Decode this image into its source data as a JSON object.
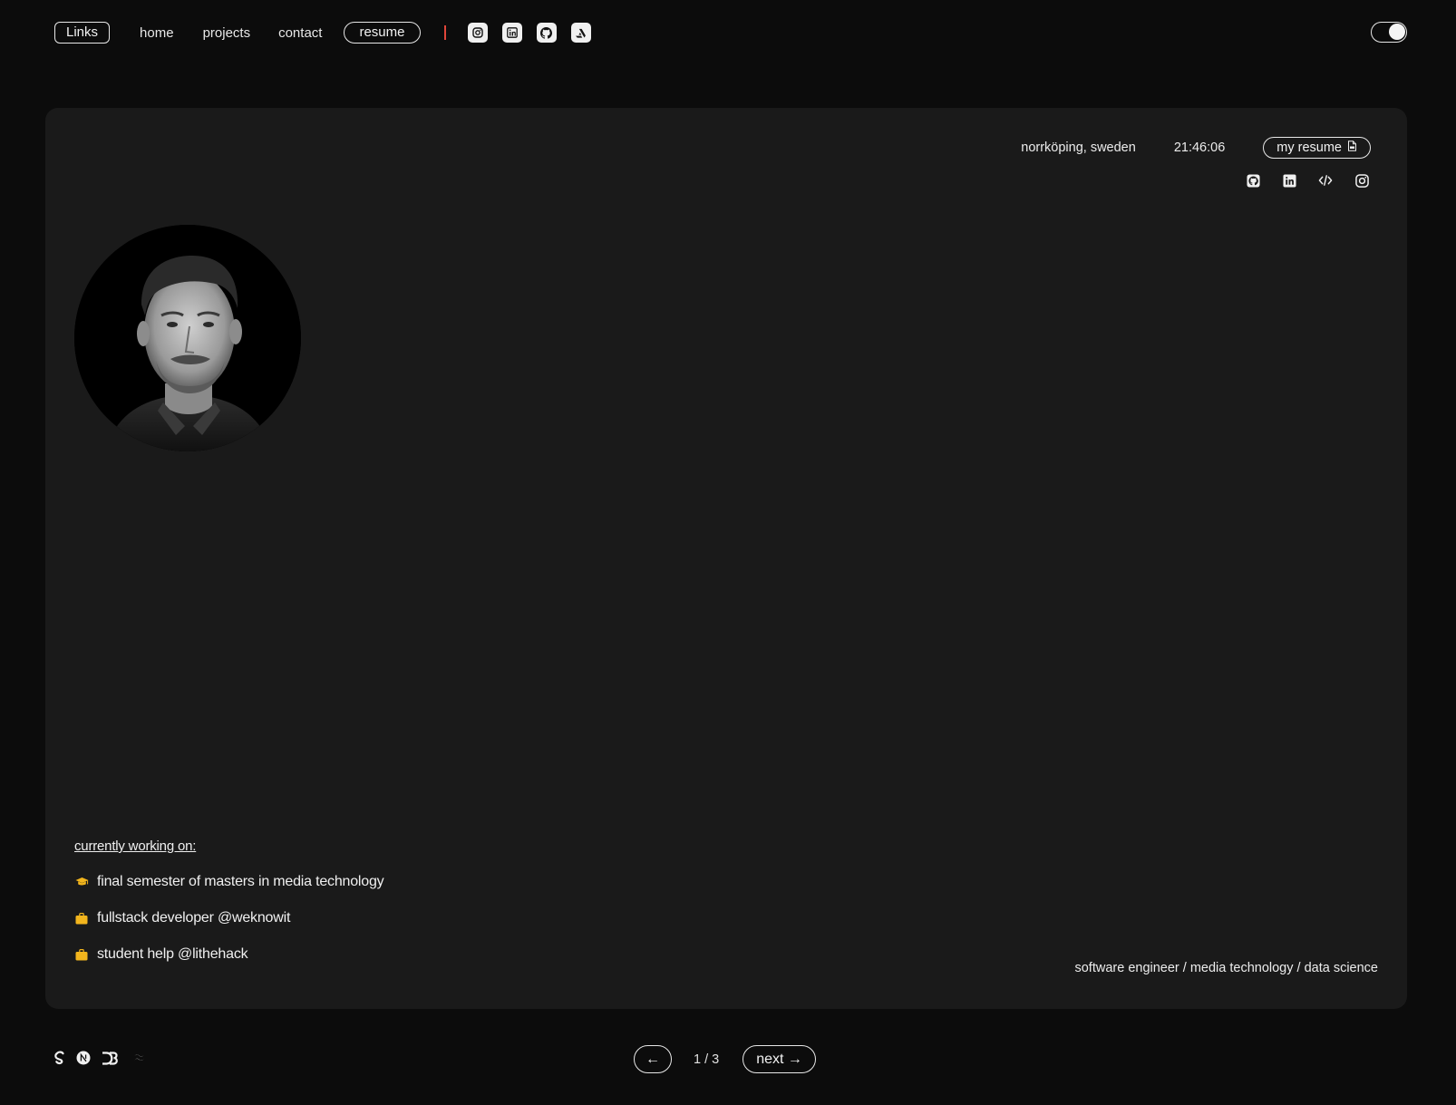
{
  "nav": {
    "links_label": "Links",
    "items": [
      {
        "label": "home"
      },
      {
        "label": "projects"
      },
      {
        "label": "contact"
      }
    ],
    "resume_label": "resume",
    "icons": [
      "instagram-icon",
      "linkedin-icon",
      "github-icon",
      "artstation-icon"
    ]
  },
  "theme_toggle": {
    "state": "dark"
  },
  "card": {
    "location": "norrköping, sweden",
    "time": "21:46:06",
    "resume_button": "my resume",
    "social_icons": [
      "github-icon",
      "linkedin-icon",
      "code-icon",
      "instagram-icon"
    ],
    "working": {
      "heading": "currently working on:",
      "items": [
        {
          "icon": "graduation-cap-icon",
          "text": "final semester of masters in media technology"
        },
        {
          "icon": "briefcase-icon",
          "text": "fullstack developer @weknowit"
        },
        {
          "icon": "briefcase-icon",
          "text": "student help @lithehack"
        }
      ]
    },
    "tagline": "software engineer / media technology / data science"
  },
  "footer": {
    "tech_icons": [
      "svelte-icon",
      "nextjs-icon",
      "d3-icon",
      "tailwind-icon"
    ],
    "prev_label": "←",
    "page_counter": "1 / 3",
    "next_label": "next →"
  },
  "colors": {
    "page_bg": "#0c0c0c",
    "card_bg": "#1a1a1a",
    "accent_separator": "#e0453a",
    "accent_icons": "#f2b51d"
  }
}
